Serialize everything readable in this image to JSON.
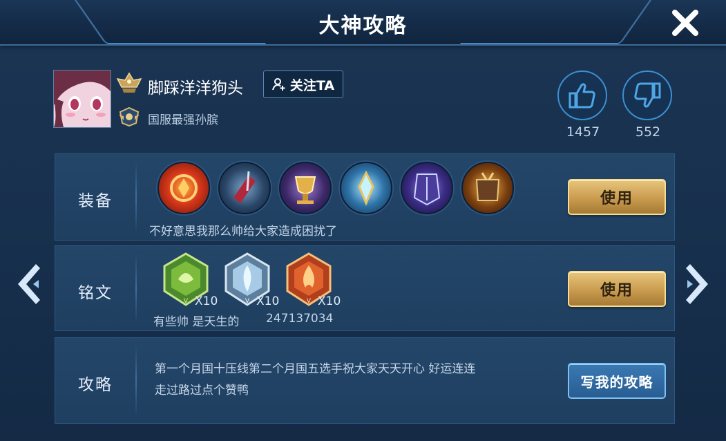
{
  "title": "大神攻略",
  "profile": {
    "username": "脚踩洋洋狗头",
    "follow_label": "关注TA",
    "user_title": "国服最强孙膑"
  },
  "votes": {
    "likes": "1457",
    "dislikes": "552"
  },
  "equipment": {
    "label": "装备",
    "items": [
      "item-1",
      "item-2",
      "item-3",
      "item-4",
      "item-5",
      "item-6"
    ],
    "description": "不好意思我那么帅给大家造成困扰了",
    "use_label": "使用"
  },
  "runes": {
    "label": "铭文",
    "items": [
      {
        "color": "green",
        "count": "X10"
      },
      {
        "color": "blue",
        "count": "X10"
      },
      {
        "color": "red",
        "count": "X10"
      }
    ],
    "description": "有些帅 是天生的",
    "number": "247137034",
    "use_label": "使用"
  },
  "guide": {
    "label": "攻略",
    "text_line1": "第一个月国十压线第二个月国五选手祝大家天天开心 好运连连",
    "text_line2": "走过路过点个赞鸭",
    "write_label": "写我的攻略"
  },
  "colors": {
    "gold_button": "#c99b4f",
    "blue_button": "#285d92",
    "panel": "#234669",
    "accent": "#3c8fd0"
  }
}
